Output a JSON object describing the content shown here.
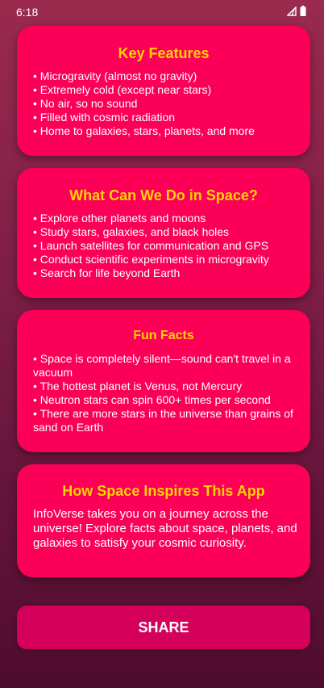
{
  "status_bar": {
    "time": "6:18",
    "icons": [
      "signal-icon",
      "battery-icon"
    ]
  },
  "cards": [
    {
      "title": "Key Features",
      "items": [
        "• Microgravity (almost no gravity)",
        "• Extremely cold (except near stars)",
        "• No air, so no sound",
        "• Filled with cosmic radiation",
        "• Home to galaxies, stars, planets, and more"
      ]
    },
    {
      "title": "What Can We Do in Space?",
      "items": [
        "• Explore other planets and moons",
        "• Study stars, galaxies, and black holes",
        "• Launch satellites for communication and GPS",
        "• Conduct scientific experiments in microgravity",
        "• Search for life beyond Earth"
      ]
    },
    {
      "title": "Fun Facts",
      "items": [
        "• Space is completely silent—sound can't travel in a vacuum",
        "• The hottest planet is Venus, not Mercury",
        "• Neutron stars can spin 600+ times per second",
        "• There are more stars in the universe than grains of sand on Earth"
      ]
    },
    {
      "title": "How Space Inspires This App",
      "text": "InfoVerse takes you on a journey across the universe! Explore facts about space, planets, and galaxies to satisfy your cosmic curiosity."
    }
  ],
  "share_button": {
    "label": "SHARE"
  },
  "colors": {
    "card_background": "#fc0058",
    "title_color": "#ffd400",
    "button_background": "#d4005c",
    "text_color": "#ffffff"
  }
}
